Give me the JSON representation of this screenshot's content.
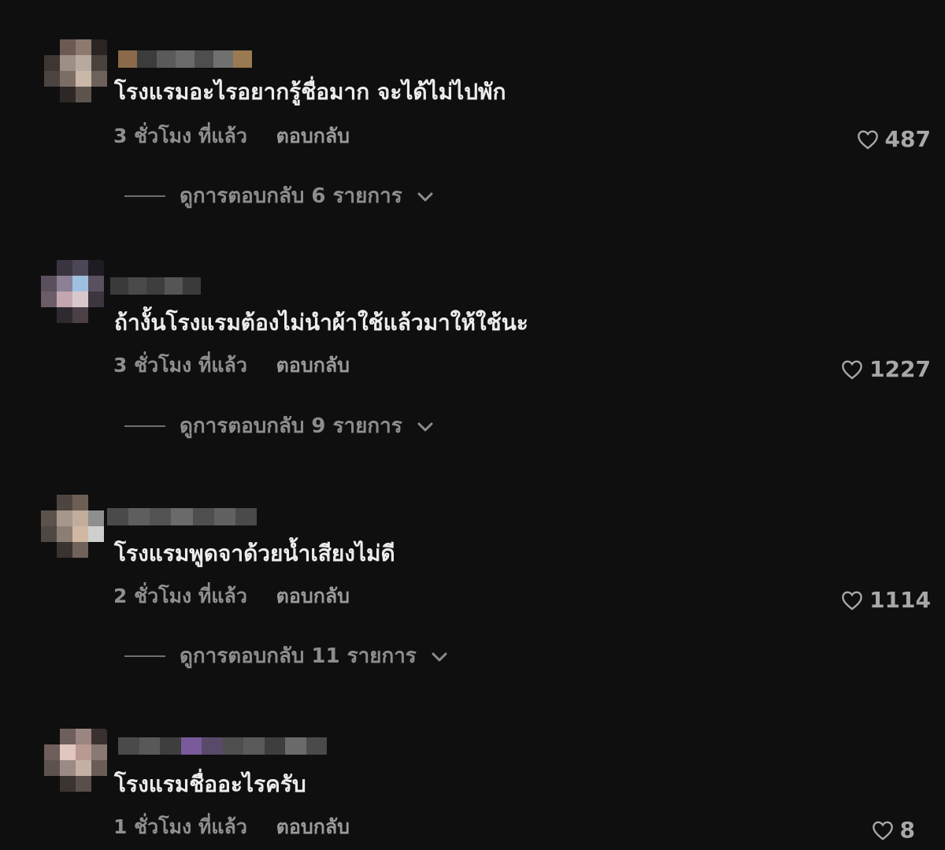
{
  "comments": [
    {
      "text": "โรงแรมอะไรอยากรู้ชื่อมาก จะได้ไม่ไปพัก",
      "time": "3 ชั่วโมง ที่แล้ว",
      "reply_label": "ตอบกลับ",
      "likes": "487",
      "view_replies": "ดูการตอบกลับ 6 รายการ"
    },
    {
      "text": "ถ้างั้นโรงแรมต้องไม่นำผ้าใช้แล้วมาให้ใช้นะ",
      "time": "3 ชั่วโมง ที่แล้ว",
      "reply_label": "ตอบกลับ",
      "likes": "1227",
      "view_replies": "ดูการตอบกลับ 9 รายการ"
    },
    {
      "text": "โรงแรมพูดจาด้วยน้ำเสียงไม่ดี",
      "time": "2 ชั่วโมง ที่แล้ว",
      "reply_label": "ตอบกลับ",
      "likes": "1114",
      "view_replies": "ดูการตอบกลับ 11 รายการ"
    },
    {
      "text": "โรงแรมชื่ออะไรครับ",
      "time": "1 ชั่วโมง ที่แล้ว",
      "reply_label": "ตอบกลับ",
      "likes": "8"
    }
  ],
  "colors": {
    "background": "#0f0f0f",
    "text": "#ececec",
    "muted": "#8f8f8f"
  },
  "icons": {
    "like": "heart-outline-icon",
    "expand": "chevron-down-icon"
  }
}
